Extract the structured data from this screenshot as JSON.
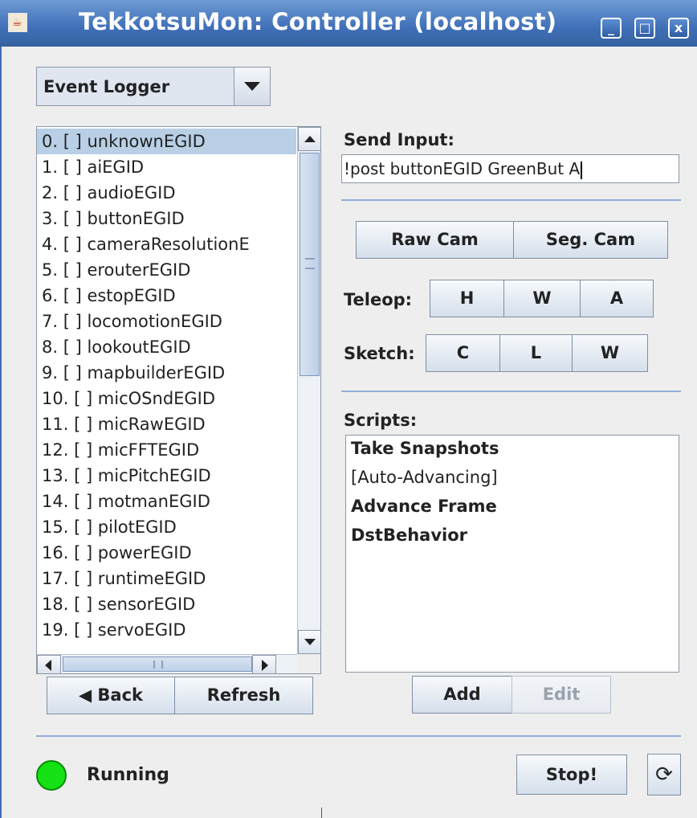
{
  "window": {
    "title": "TekkotsuMon: Controller (localhost)",
    "controls": {
      "minimize": "_",
      "maximize": "□",
      "close": "x"
    }
  },
  "mode_select": {
    "selected": "Event Logger"
  },
  "event_list": {
    "items": [
      "0. [ ] unknownEGID",
      "1. [ ] aiEGID",
      "2. [ ] audioEGID",
      "3. [ ] buttonEGID",
      "4. [ ] cameraResolutionE",
      "5. [ ] erouterEGID",
      "6. [ ] estopEGID",
      "7. [ ] locomotionEGID",
      "8. [ ] lookoutEGID",
      "9. [ ] mapbuilderEGID",
      "10. [ ] micOSndEGID",
      "11. [ ] micRawEGID",
      "12. [ ] micFFTEGID",
      "13. [ ] micPitchEGID",
      "14. [ ] motmanEGID",
      "15. [ ] pilotEGID",
      "16. [ ] powerEGID",
      "17. [ ] runtimeEGID",
      "18. [ ] sensorEGID",
      "19. [ ] servoEGID"
    ],
    "selected_index": 0
  },
  "nav": {
    "back_label": "◀ Back",
    "refresh_label": "Refresh"
  },
  "send_input": {
    "label": "Send Input:",
    "value": "!post buttonEGID GreenBut A"
  },
  "camera": {
    "raw_label": "Raw Cam",
    "seg_label": "Seg. Cam"
  },
  "teleop": {
    "label": "Teleop:",
    "buttons": [
      "H",
      "W",
      "A"
    ]
  },
  "sketch": {
    "label": "Sketch:",
    "buttons": [
      "C",
      "L",
      "W"
    ]
  },
  "scripts": {
    "label": "Scripts:",
    "items": [
      "Take Snapshots",
      "[Auto-Advancing]",
      "Advance Frame",
      "DstBehavior"
    ],
    "add_label": "Add",
    "edit_label": "Edit"
  },
  "status": {
    "text": "Running",
    "color": "#14e214",
    "stop_label": "Stop!"
  },
  "colors": {
    "title_bar": "#3f6fb8",
    "selection": "#b8cfe5",
    "separator": "#92acd6"
  }
}
